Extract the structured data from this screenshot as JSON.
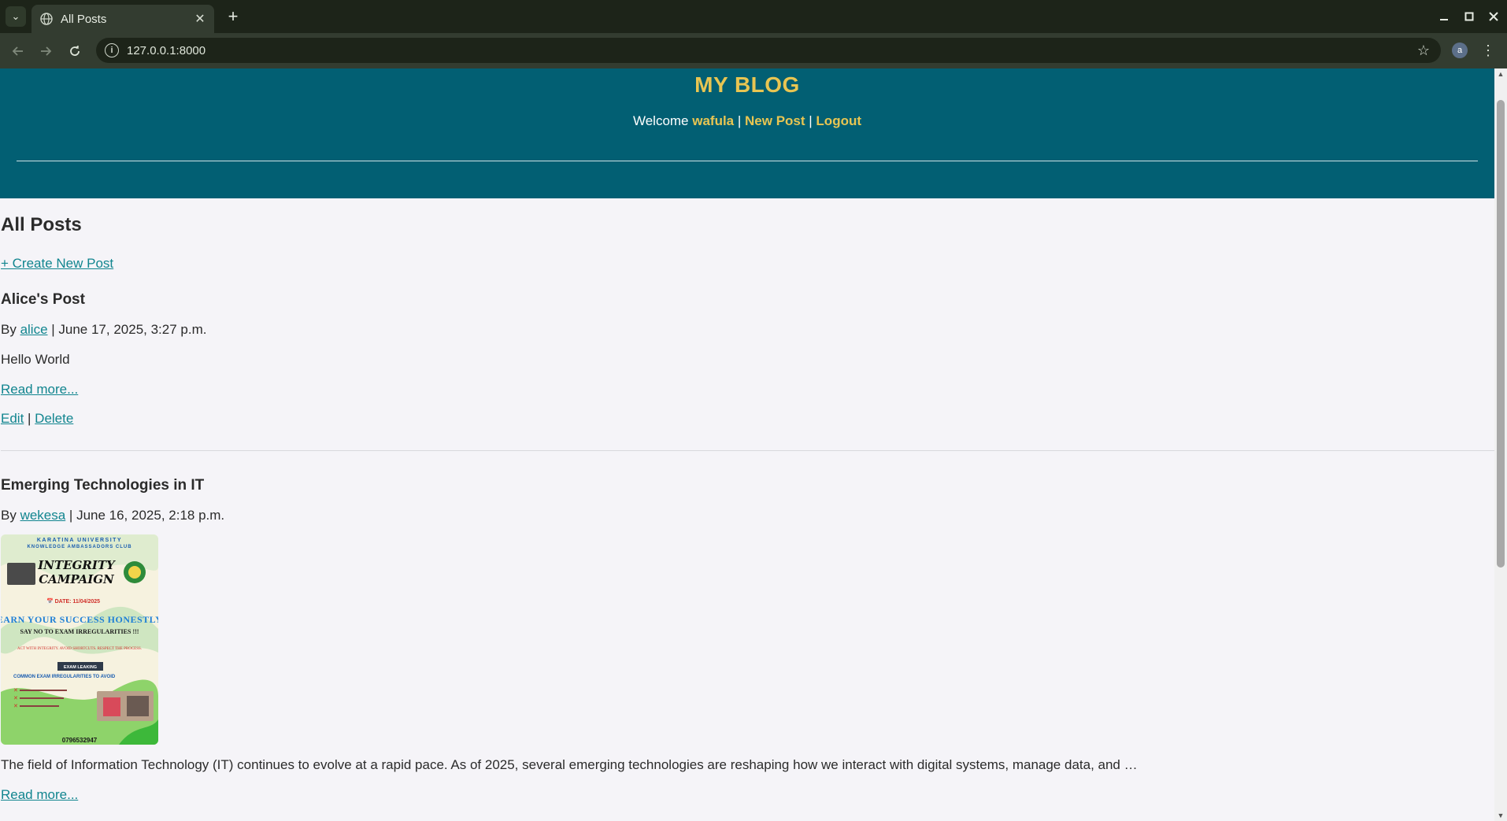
{
  "browser": {
    "tab_title": "All Posts",
    "url": "127.0.0.1:8000",
    "profile_initial": "a"
  },
  "site": {
    "brand": "MY BLOG",
    "welcome_prefix": "Welcome ",
    "username": "wafula",
    "sep": " | ",
    "new_post": "New Post",
    "logout": "Logout"
  },
  "main": {
    "heading": "All Posts",
    "create_link": "+ Create New Post",
    "posts": [
      {
        "title": "Alice's Post",
        "by": "By ",
        "author": "alice",
        "date": " | June 17, 2025, 3:27 p.m.",
        "excerpt": "Hello World",
        "read_more": "Read more...",
        "edit": "Edit",
        "action_sep": " | ",
        "delete": "Delete"
      },
      {
        "title": "Emerging Technologies in IT",
        "by": "By ",
        "author": "wekesa",
        "date": " | June 16, 2025, 2:18 p.m.",
        "excerpt": "The field of Information Technology (IT) continues to evolve at a rapid pace. As of 2025, several emerging technologies are reshaping how we interact with digital systems, manage data, and …",
        "read_more": "Read more...",
        "image": {
          "l1": "KARATINA UNIVERSITY",
          "l2": "KNOWLEDGE AMBASSADORS CLUB",
          "l3": "INTEGRITY",
          "l4": "CAMPAIGN",
          "l5": "📅 DATE: 11/04/2025",
          "l6": "EARN YOUR SUCCESS HONESTLY",
          "l7": "SAY NO TO EXAM IRREGULARITIES !!!",
          "l8": "ACT WITH INTEGRITY. AVOID SHORTCUTS. RESPECT THE PROCESS.",
          "l9": "EXAM LEAKING",
          "l10": "COMMON EXAM IRREGULARITIES TO AVOID",
          "l11": "0796532947"
        }
      }
    ]
  },
  "colors": {
    "header_bg": "#025f73",
    "brand": "#e8c552",
    "link": "#11858f"
  }
}
